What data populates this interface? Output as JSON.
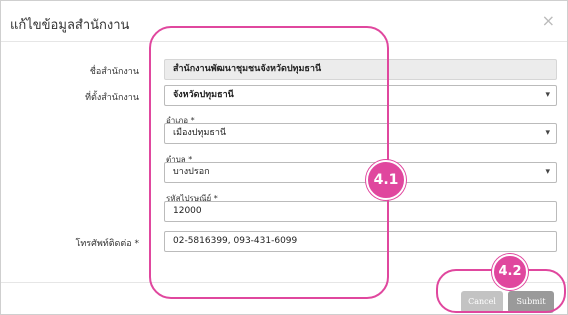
{
  "modal": {
    "title": "แก้ไขข้อมูลสำนักงาน",
    "close_label": "×"
  },
  "form": {
    "office_name_label": "ชื่อสำนักงาน",
    "office_name_value": "สำนักงานพัฒนาชุมชนจังหวัดปทุมธานี",
    "office_location_label": "ที่ตั้งสำนักงาน",
    "province_value": "จังหวัดปทุมธานี",
    "district_label": "อำเภอ *",
    "district_value": "เมืองปทุมธานี",
    "subdistrict_label": "ตำบล *",
    "subdistrict_value": "บางปรอก",
    "postal_label": "รหัสไปรษณีย์ *",
    "postal_value": "12000",
    "phone_label": "โทรศัพท์ติดต่อ *",
    "phone_value": "02-5816399, 093-431-6099"
  },
  "footer": {
    "cancel_label": "Cancel",
    "submit_label": "Submit"
  },
  "annotations": {
    "badge_1": "4.1",
    "badge_2": "4.2",
    "accent_color": "#e0479e"
  }
}
